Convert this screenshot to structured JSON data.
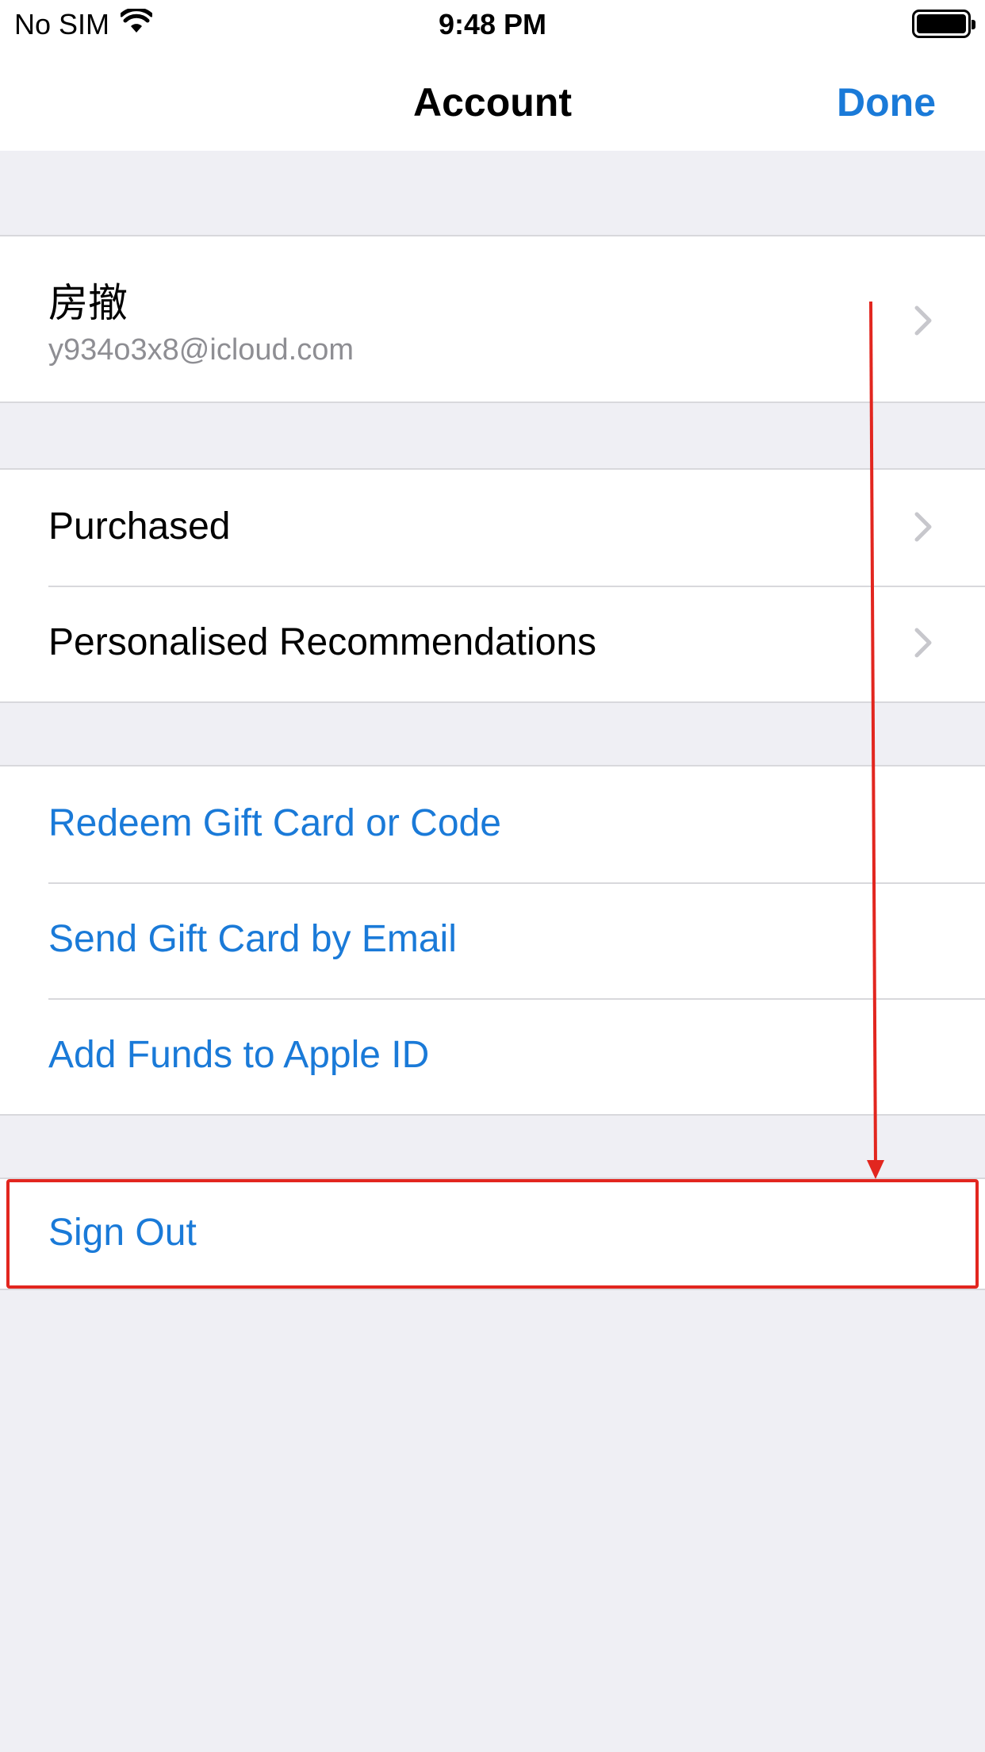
{
  "status_bar": {
    "carrier": "No SIM",
    "time": "9:48 PM"
  },
  "nav": {
    "title": "Account",
    "done_label": "Done"
  },
  "account": {
    "name": "房撤",
    "email": "y934o3x8@icloud.com"
  },
  "section_store": {
    "items": [
      {
        "label": "Purchased"
      },
      {
        "label": "Personalised Recommendations"
      }
    ]
  },
  "section_gift": {
    "items": [
      {
        "label": "Redeem Gift Card or Code"
      },
      {
        "label": "Send Gift Card by Email"
      },
      {
        "label": "Add Funds to Apple ID"
      }
    ]
  },
  "section_signout": {
    "label": "Sign Out"
  },
  "colors": {
    "accent": "#1a7ad8",
    "annotation": "#e2261f",
    "background": "#efeff4"
  },
  "icons": [
    "wifi-icon",
    "battery-icon",
    "chevron-right-icon",
    "annotation-arrow"
  ]
}
